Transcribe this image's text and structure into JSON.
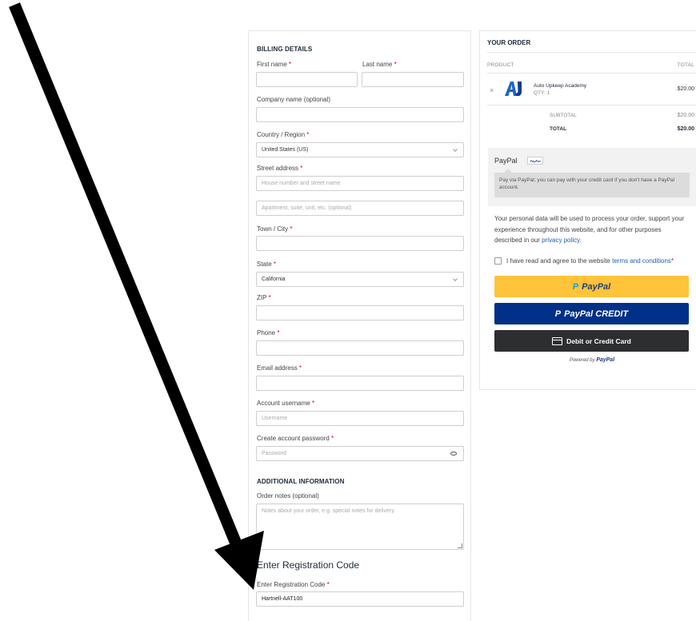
{
  "billing": {
    "title": "BILLING DETAILS",
    "first_name_label": "First name",
    "last_name_label": "Last name",
    "company_label": "Company name (optional)",
    "country_label": "Country / Region",
    "country_value": "United States (US)",
    "street_label": "Street address",
    "street_placeholder": "House number and street name",
    "apartment_placeholder": "Apartment, suite, unit, etc. (optional)",
    "city_label": "Town / City",
    "state_label": "State",
    "state_value": "California",
    "zip_label": "ZIP",
    "phone_label": "Phone",
    "email_label": "Email address",
    "username_label": "Account username",
    "username_placeholder": "Username",
    "password_label": "Create account password",
    "password_placeholder": "Password",
    "required_mark": "*"
  },
  "additional": {
    "title": "ADDITIONAL INFORMATION",
    "notes_label": "Order notes (optional)",
    "notes_placeholder": "Notes about your order, e.g. special notes for delivery."
  },
  "registration": {
    "heading": "Enter Registration Code",
    "label": "Enter Registration Code",
    "value": "Hartnell-AAT100"
  },
  "order": {
    "title": "YOUR ORDER",
    "col_product": "PRODUCT",
    "col_total": "TOTAL",
    "remove_glyph": "×",
    "product_name": "Auto Upkeep Academy",
    "product_qty": "QTY:  1",
    "product_price": "$20.00",
    "subtotal_label": "SUBTOTAL",
    "subtotal_value": "$20.00",
    "total_label": "TOTAL",
    "total_value": "$20.00"
  },
  "payment": {
    "method": "PayPal",
    "badge": "PayPal",
    "description": "Pay via PayPal; you can pay with your credit card if you don't have a PayPal account.",
    "privacy_text": "Your personal data will be used to process your order, support your experience throughout this website, and for other purposes described in our ",
    "privacy_link": "privacy policy",
    "privacy_end": ".",
    "terms_text": "I have read and agree to the website ",
    "terms_link": "terms and conditions",
    "terms_req": " *",
    "btn_paypal_p": "P",
    "btn_paypal": "PayPal",
    "btn_credit_p": "P",
    "btn_credit": "PayPal CREDIT",
    "btn_card": "Debit or Credit Card",
    "powered_by": "Powered by ",
    "powered_brand": "PayPal"
  },
  "colors": {
    "paypal_yellow": "#ffc439",
    "paypal_blue": "#003087",
    "card_dark": "#2c2e2f",
    "required_red": "#d0021b",
    "link_blue": "#1f5fb5",
    "arrow": "#000000"
  }
}
